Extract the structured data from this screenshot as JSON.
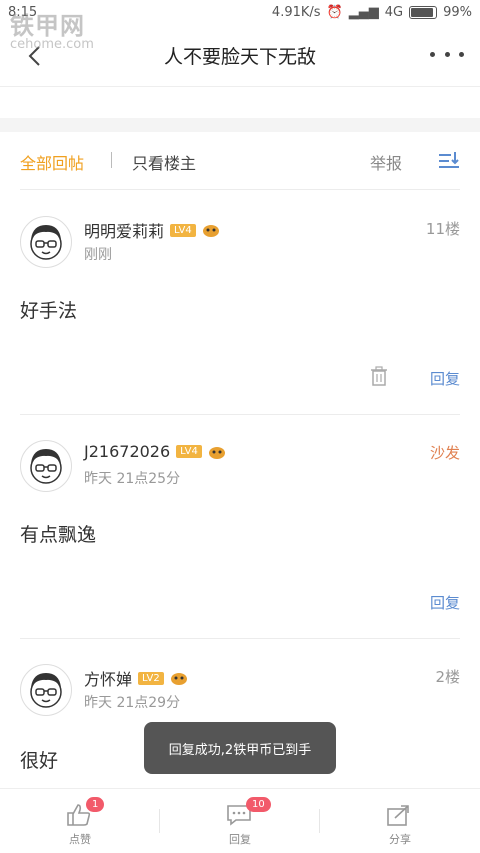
{
  "status_bar": {
    "time": "8:15",
    "speed": "4.91K/s",
    "network": "4G",
    "battery": "99%"
  },
  "watermark": {
    "text": "铁甲网",
    "url": "cehome.com"
  },
  "nav": {
    "title": "人不要脸天下无敌"
  },
  "filter": {
    "all_replies": "全部回帖",
    "owner_only": "只看楼主",
    "report": "举报"
  },
  "posts": [
    {
      "user": "明明爱莉莉",
      "level": "LV4",
      "time": "刚刚",
      "floor": "11楼",
      "content": "好手法",
      "reply": "回复"
    },
    {
      "user": "J21672026",
      "level": "LV4",
      "time": "昨天 21点25分",
      "floor": "沙发",
      "content": "有点飘逸",
      "reply": "回复"
    },
    {
      "user": "方怀婵",
      "level": "LV2",
      "time": "昨天 21点29分",
      "floor": "2楼",
      "content": "很好"
    }
  ],
  "toast": "回复成功,2铁甲币已到手",
  "bottom_bar": {
    "like": {
      "label": "点赞",
      "badge": "1"
    },
    "reply": {
      "label": "回复",
      "badge": "10"
    },
    "share": {
      "label": "分享"
    }
  },
  "colors": {
    "accent": "#f0a020",
    "link": "#5b8bd0",
    "sofa": "#e08050",
    "badge": "#f25a6a"
  }
}
